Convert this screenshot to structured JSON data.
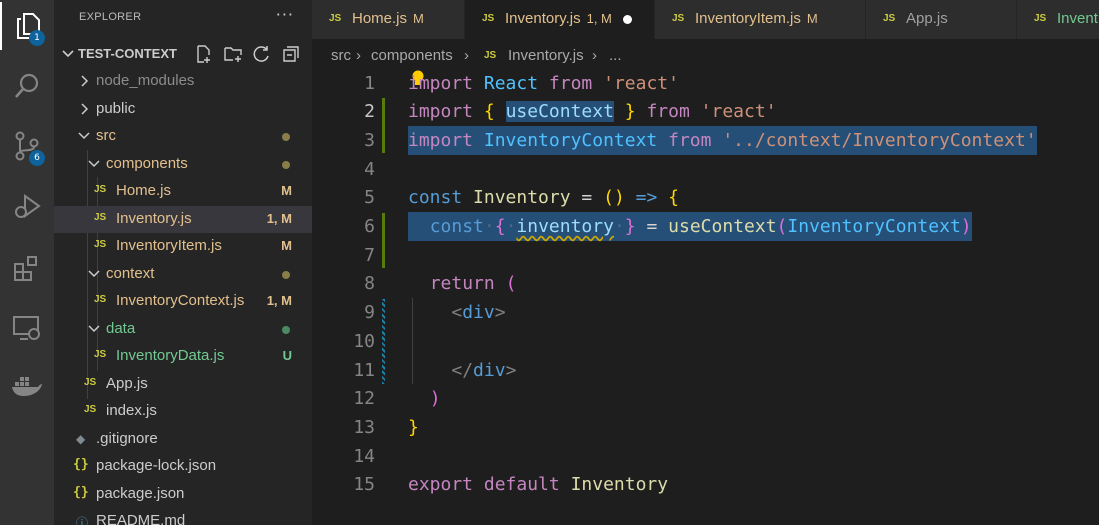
{
  "activity_bar": {
    "explorer_badge": "1",
    "scm_badge": "6"
  },
  "sidebar": {
    "title": "EXPLORER",
    "more": "···",
    "project": "TEST-CONTEXT",
    "items": [
      {
        "label": "node_modules",
        "kind": "folder",
        "state": "collapsed"
      },
      {
        "label": "public",
        "kind": "folder",
        "state": "collapsed"
      },
      {
        "label": "src",
        "kind": "folder",
        "state": "expanded"
      },
      {
        "label": "components",
        "kind": "folder",
        "state": "expanded"
      },
      {
        "label": "Home.js",
        "kind": "js",
        "status": "M"
      },
      {
        "label": "Inventory.js",
        "kind": "js",
        "status": "1, M"
      },
      {
        "label": "InventoryItem.js",
        "kind": "js",
        "status": "M"
      },
      {
        "label": "context",
        "kind": "folder",
        "state": "expanded"
      },
      {
        "label": "InventoryContext.js",
        "kind": "js",
        "status": "1, M"
      },
      {
        "label": "data",
        "kind": "folder",
        "state": "expanded"
      },
      {
        "label": "InventoryData.js",
        "kind": "js",
        "status": "U"
      },
      {
        "label": "App.js",
        "kind": "js"
      },
      {
        "label": "index.js",
        "kind": "js"
      },
      {
        "label": ".gitignore",
        "kind": "git"
      },
      {
        "label": "package-lock.json",
        "kind": "json"
      },
      {
        "label": "package.json",
        "kind": "json"
      },
      {
        "label": "README.md",
        "kind": "md"
      }
    ],
    "colors": {
      "modified": "#e2c08d",
      "untracked": "#73c991",
      "normal": "#cccccc"
    }
  },
  "tabs": [
    {
      "label": "Home.js",
      "status": "M"
    },
    {
      "label": "Inventory.js",
      "status": "1, M"
    },
    {
      "label": "InventoryItem.js",
      "status": "M"
    },
    {
      "label": "App.js",
      "status": ""
    },
    {
      "label": "Invent",
      "status": ""
    }
  ],
  "js_icon": "JS",
  "json_icon": "{}",
  "breadcrumb": {
    "src": "src",
    "components": "components",
    "file": "Inventory.js",
    "tail": "..."
  },
  "editor": {
    "line_numbers": [
      "1",
      "2",
      "3",
      "4",
      "5",
      "6",
      "7",
      "8",
      "9",
      "10",
      "11",
      "12",
      "13",
      "14",
      "15"
    ],
    "current_line": 2
  }
}
